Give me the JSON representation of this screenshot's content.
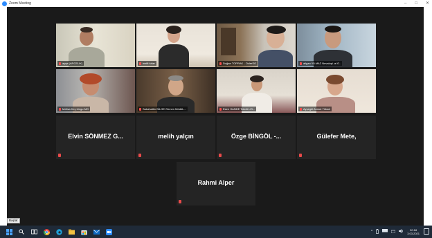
{
  "window": {
    "title": "Zoom Meeting",
    "controls": [
      "–",
      "□",
      "✕"
    ]
  },
  "video_tiles": [
    {
      "name": "ayşe (ARCELIK)",
      "active": true
    },
    {
      "name": "melit tufan",
      "active": false
    },
    {
      "name": "Doğan TOPRAK - OzlerSO",
      "active": false
    },
    {
      "name": "aligan YILMAZ Nevaluşi..ai G..",
      "active": false
    },
    {
      "name": "Melisa Keç bingu MO",
      "active": false
    },
    {
      "name": "Sabahattin BİLGE Özmen MüdüL...",
      "active": false
    },
    {
      "name": "Esen HANDE Tokdü LIS...",
      "active": false
    },
    {
      "name": "Ayşegül Akmut Yüksel",
      "active": false
    }
  ],
  "name_tiles": [
    {
      "label": "Elvin SÖNMEZ G..."
    },
    {
      "label": "melih yalçın"
    },
    {
      "label": "Özge BİNGÖL -..."
    },
    {
      "label": "Gülefer Mete,"
    },
    {
      "label": "Rahmi Alper"
    }
  ],
  "tooltip": "Başlat",
  "taskbar": {
    "clock_time": "20:18",
    "clock_date": "3.03.2021"
  },
  "colors": {
    "meeting_bg": "#1a1a1a",
    "active_border": "#b9d85a",
    "taskbar_bg": "#1f2a38",
    "zoom_blue": "#2d8cff"
  }
}
